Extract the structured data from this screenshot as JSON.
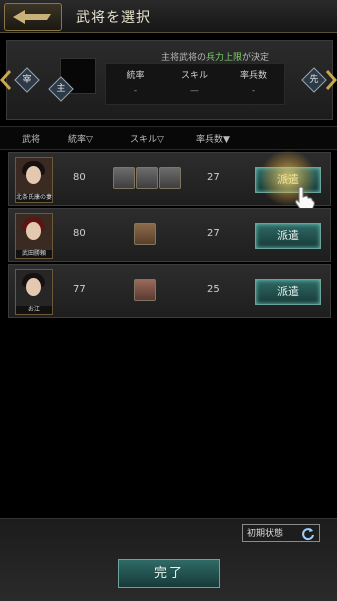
{
  "header": {
    "title": "武将を選択"
  },
  "top_panel": {
    "left_badge": "宰",
    "right_badge": "先",
    "leader_badge": "主",
    "condition_prefix": "主将武将の",
    "condition_highlight": "兵力上限",
    "condition_suffix": "が決定",
    "stats": [
      {
        "label": "統率",
        "value": "-"
      },
      {
        "label": "スキル",
        "value": "—"
      },
      {
        "label": "率兵数",
        "value": "-"
      }
    ]
  },
  "columns": [
    "武将",
    "統率▽",
    "スキル▽",
    "率兵数▼"
  ],
  "rows": [
    {
      "name": "北条氏康の妻",
      "command": "80",
      "troops": "27",
      "skills": [
        "skill-scroll-icon",
        "skill-banner-icon",
        "skill-wing-icon"
      ],
      "action": "派遣"
    },
    {
      "name": "武田勝頼",
      "command": "80",
      "troops": "27",
      "skills": [
        "skill-spear-icon"
      ],
      "action": "派遣"
    },
    {
      "name": "お江",
      "command": "77",
      "troops": "25",
      "skills": [
        "skill-portrait-icon"
      ],
      "action": "派遣"
    }
  ],
  "footer": {
    "reset_label": "初期状態",
    "done_label": "完了"
  },
  "colors": {
    "accent_teal": "#2f6a66",
    "highlight_green": "#7dd36a",
    "gold_border": "#8a7748"
  }
}
